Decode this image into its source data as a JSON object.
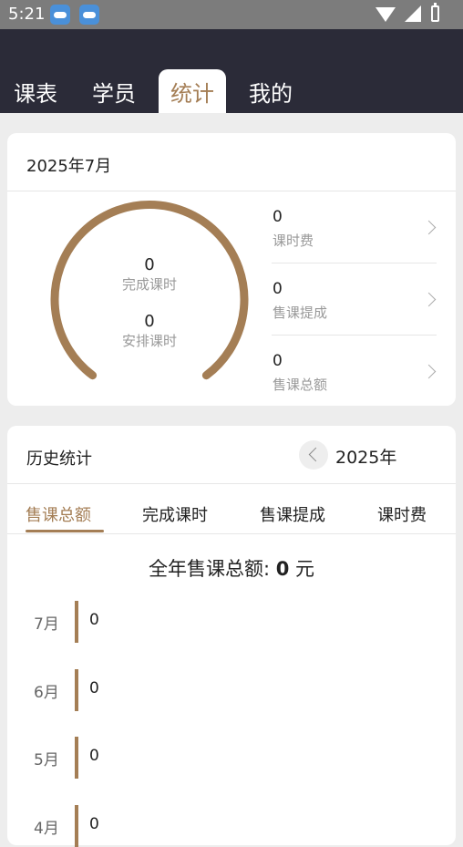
{
  "status_bar": {
    "time": "5:21",
    "icons": [
      "weather-app-icon",
      "weather-app-icon",
      "wifi-icon",
      "signal-icon",
      "battery-charging-icon"
    ]
  },
  "tabs": [
    {
      "label": "课表",
      "active": false
    },
    {
      "label": "学员",
      "active": false
    },
    {
      "label": "统计",
      "active": true
    },
    {
      "label": "我的",
      "active": false
    }
  ],
  "monthly": {
    "title": "2025年7月",
    "gauge": {
      "completed_value": "0",
      "completed_label": "完成课时",
      "scheduled_value": "0",
      "scheduled_label": "安排课时",
      "color": "#a47e55"
    },
    "stats": [
      {
        "value": "0",
        "label": "课时费"
      },
      {
        "value": "0",
        "label": "售课提成"
      },
      {
        "value": "0",
        "label": "售课总额"
      }
    ]
  },
  "history": {
    "title": "历史统计",
    "year": "2025年",
    "subtabs": [
      {
        "label": "售课总额",
        "active": true
      },
      {
        "label": "完成课时",
        "active": false
      },
      {
        "label": "售课提成",
        "active": false
      },
      {
        "label": "课时费",
        "active": false
      }
    ],
    "total_label": "全年售课总额: ",
    "total_value": "0",
    "total_unit": " 元",
    "months": [
      {
        "month": "7月",
        "value": "0"
      },
      {
        "month": "6月",
        "value": "0"
      },
      {
        "month": "5月",
        "value": "0"
      },
      {
        "month": "4月",
        "value": "0"
      }
    ]
  },
  "colors": {
    "accent": "#a47e55",
    "header_bg": "#2b2b38",
    "page_bg": "#ededed"
  }
}
